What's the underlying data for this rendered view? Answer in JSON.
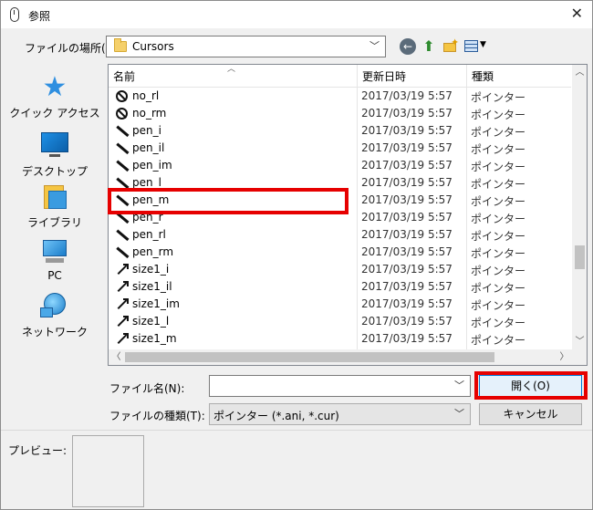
{
  "window": {
    "title": "参照"
  },
  "lookin": {
    "label": "ファイルの場所(I):",
    "value": "Cursors"
  },
  "places": [
    {
      "label": "クイック アクセス",
      "icon": "star-icon"
    },
    {
      "label": "デスクトップ",
      "icon": "desktop-icon"
    },
    {
      "label": "ライブラリ",
      "icon": "library-icon"
    },
    {
      "label": "PC",
      "icon": "pc-icon"
    },
    {
      "label": "ネットワーク",
      "icon": "network-icon"
    }
  ],
  "list": {
    "columns": [
      "名前",
      "更新日時",
      "種類"
    ],
    "rows": [
      {
        "name": "no_rl",
        "date": "2017/03/19 5:57",
        "type": "ポインター",
        "icon": "no"
      },
      {
        "name": "no_rm",
        "date": "2017/03/19 5:57",
        "type": "ポインター",
        "icon": "no"
      },
      {
        "name": "pen_i",
        "date": "2017/03/19 5:57",
        "type": "ポインター",
        "icon": "pen"
      },
      {
        "name": "pen_il",
        "date": "2017/03/19 5:57",
        "type": "ポインター",
        "icon": "pen"
      },
      {
        "name": "pen_im",
        "date": "2017/03/19 5:57",
        "type": "ポインター",
        "icon": "pen"
      },
      {
        "name": "pen_l",
        "date": "2017/03/19 5:57",
        "type": "ポインター",
        "icon": "pen"
      },
      {
        "name": "pen_m",
        "date": "2017/03/19 5:57",
        "type": "ポインター",
        "icon": "pen"
      },
      {
        "name": "pen_r",
        "date": "2017/03/19 5:57",
        "type": "ポインター",
        "icon": "pen"
      },
      {
        "name": "pen_rl",
        "date": "2017/03/19 5:57",
        "type": "ポインター",
        "icon": "pen"
      },
      {
        "name": "pen_rm",
        "date": "2017/03/19 5:57",
        "type": "ポインター",
        "icon": "pen"
      },
      {
        "name": "size1_i",
        "date": "2017/03/19 5:57",
        "type": "ポインター",
        "icon": "size"
      },
      {
        "name": "size1_il",
        "date": "2017/03/19 5:57",
        "type": "ポインター",
        "icon": "size"
      },
      {
        "name": "size1_im",
        "date": "2017/03/19 5:57",
        "type": "ポインター",
        "icon": "size"
      },
      {
        "name": "size1_l",
        "date": "2017/03/19 5:57",
        "type": "ポインター",
        "icon": "size"
      },
      {
        "name": "size1_m",
        "date": "2017/03/19 5:57",
        "type": "ポインター",
        "icon": "size"
      }
    ]
  },
  "filename": {
    "label": "ファイル名(N):",
    "value": ""
  },
  "filetype": {
    "label": "ファイルの種類(T):",
    "value": "ポインター (*.ani, *.cur)"
  },
  "buttons": {
    "open": "開く(O)",
    "cancel": "キャンセル"
  },
  "preview": {
    "label": "プレビュー:"
  },
  "colors": {
    "highlight": "#e60000",
    "accent": "#0078d7"
  }
}
